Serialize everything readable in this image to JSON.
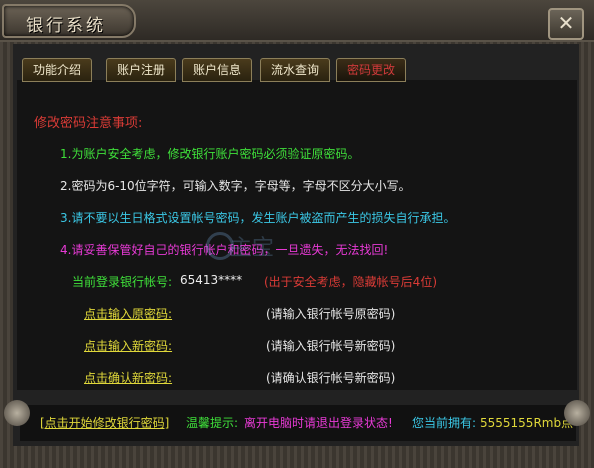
{
  "window": {
    "title": "银行系统",
    "close_glyph": "✕"
  },
  "tabs": [
    {
      "label": "功能介绍",
      "active": false
    },
    {
      "label": "账户注册",
      "active": false
    },
    {
      "label": "账户信息",
      "active": false
    },
    {
      "label": "流水查询",
      "active": false
    },
    {
      "label": "密码更改",
      "active": true
    }
  ],
  "notice": {
    "title": "修改密码注意事项:",
    "rules": [
      "1.为账户安全考虑，修改银行账户密码必须验证原密码。",
      "2.密码为6-10位字符，可输入数字，字母等，字母不区分大小写。",
      "3.请不要以生日格式设置帐号密码，发生账户被盗而产生的损失自行承担。",
      "4.请妥善保管好自己的银行帐户和密码，一旦遗失，无法找回!"
    ]
  },
  "account": {
    "label": "当前登录银行帐号:",
    "value": "65413****",
    "note": "(出于安全考虑，隐藏帐号后4位)"
  },
  "fields": [
    {
      "link": "点击输入原密码",
      "colon": ":",
      "hint": "(请输入银行帐号原密码)"
    },
    {
      "link": "点击输入新密码",
      "colon": ":",
      "hint": "(请输入银行帐号新密码)"
    },
    {
      "link": "点击确认新密码",
      "colon": ":",
      "hint": "(请确认银行帐号新密码)"
    }
  ],
  "footer": {
    "button": "[点击开始修改银行密码]",
    "tip_label": "温馨提示:",
    "tip_text": "离开电脑时请退出登录状态!",
    "own_label": "您当前拥有:",
    "own_value": "5555155Rmb点"
  },
  "watermark": {
    "text": "主宝"
  },
  "colors": {
    "green": "#3fe03a",
    "red": "#d93b36",
    "cyan": "#3bc8e6",
    "magenta": "#e83ad6",
    "yellow": "#e0d83a"
  },
  "icons": {
    "close": "close-icon"
  }
}
